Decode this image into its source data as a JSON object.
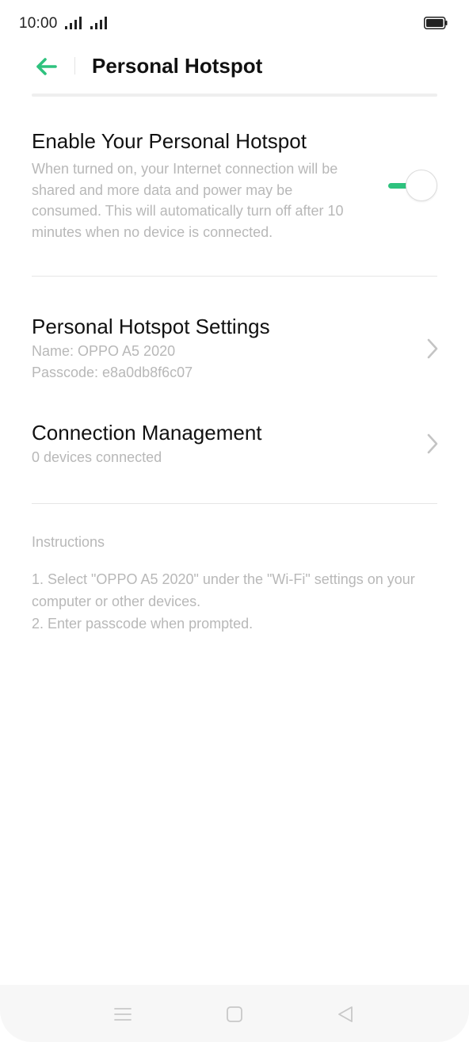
{
  "status_bar": {
    "time": "10:00"
  },
  "header": {
    "title": "Personal Hotspot",
    "back_icon": "arrow-left-icon"
  },
  "enable": {
    "title": "Enable Your Personal Hotspot",
    "description": "When turned on, your Internet connection will be shared and more data and power may be consumed. This will automatically turn off after 10 minutes when no device is connected.",
    "toggle_on": true
  },
  "settings": {
    "title": "Personal Hotspot Settings",
    "name_line": "Name: OPPO A5 2020",
    "passcode_line": "Passcode: e8a0db8f6c07"
  },
  "connection": {
    "title": "Connection Management",
    "subtitle": "0 devices connected"
  },
  "instructions": {
    "heading": "Instructions",
    "step_1": "1. Select \"OPPO A5 2020\" under the \"Wi-Fi\" settings on your computer or other devices.",
    "step_2": "2. Enter passcode when prompted."
  },
  "nav_bar": {
    "icons": [
      "menu-icon",
      "home-icon",
      "back-triangle-icon"
    ]
  },
  "colors": {
    "accent": "#2ec27e",
    "secondary_text": "#b8b8b8",
    "divider": "#e6e6e6",
    "nav_background": "#f7f7f7"
  }
}
